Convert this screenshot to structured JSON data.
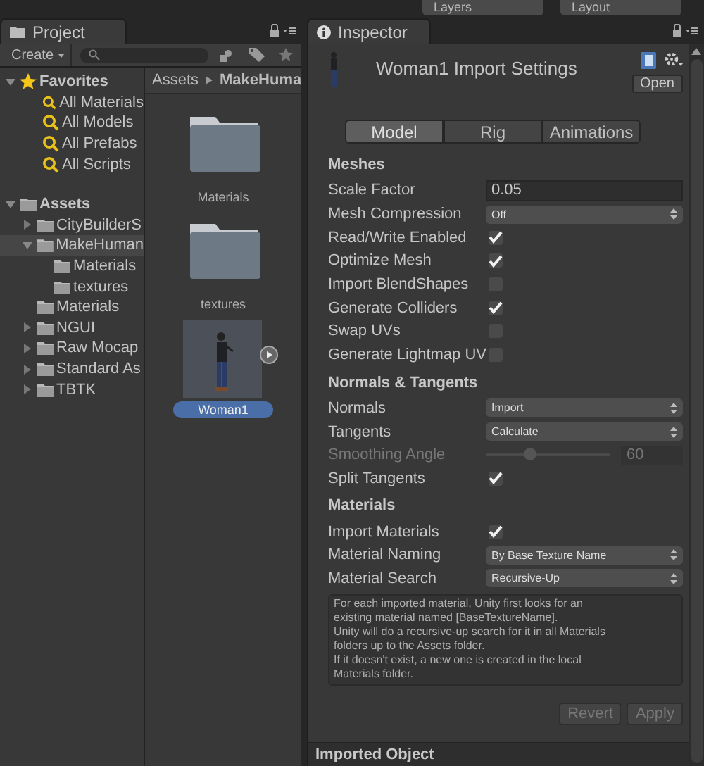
{
  "top_bar": {
    "dropdowns": [
      "Layers",
      "Layout"
    ]
  },
  "project": {
    "tab": "Project",
    "create_button": "Create",
    "tree": [
      {
        "label": "Favorites",
        "kind": "favorites",
        "expanded": true,
        "selected": false,
        "children": [
          {
            "label": "All Materials",
            "kind": "search",
            "selected": false
          },
          {
            "label": "All Models",
            "kind": "search",
            "selected": false
          },
          {
            "label": "All Prefabs",
            "kind": "search",
            "selected": false
          },
          {
            "label": "All Scripts",
            "kind": "search",
            "selected": false
          }
        ]
      },
      {
        "label": "Assets",
        "kind": "folder",
        "expanded": true,
        "selected": false,
        "children": [
          {
            "label": "CityBuilderS",
            "kind": "folder",
            "expanded": false,
            "selected": false
          },
          {
            "label": "MakeHuman",
            "kind": "folder",
            "expanded": true,
            "selected": true,
            "children": [
              {
                "label": "Materials",
                "kind": "folder",
                "selected": false
              },
              {
                "label": "textures",
                "kind": "folder",
                "selected": false
              }
            ]
          },
          {
            "label": "Materials",
            "kind": "folder",
            "selected": false
          },
          {
            "label": "NGUI",
            "kind": "folder",
            "expanded": false,
            "selected": false
          },
          {
            "label": "Raw Mocap",
            "kind": "folder",
            "expanded": false,
            "selected": false
          },
          {
            "label": "Standard As",
            "kind": "folder",
            "expanded": false,
            "selected": false
          },
          {
            "label": "TBTK",
            "kind": "folder",
            "expanded": false,
            "selected": false
          }
        ]
      }
    ],
    "breadcrumb": [
      "Assets",
      "MakeHuma"
    ],
    "assets": [
      {
        "label": "Materials",
        "kind": "folder",
        "selected": false
      },
      {
        "label": "textures",
        "kind": "folder",
        "selected": false
      },
      {
        "label": "Woman1",
        "kind": "model",
        "selected": true
      }
    ]
  },
  "inspector": {
    "tab": "Inspector",
    "title": "Woman1 Import Settings",
    "open_button": "Open",
    "tabs": [
      {
        "label": "Model",
        "selected": true
      },
      {
        "label": "Rig",
        "selected": false
      },
      {
        "label": "Animations",
        "selected": false
      }
    ],
    "sections": [
      {
        "title": "Meshes",
        "rows": [
          {
            "kind": "text",
            "label": "Scale Factor",
            "value": "0.05"
          },
          {
            "kind": "dropdown",
            "label": "Mesh Compression",
            "value": "Off"
          },
          {
            "kind": "checkbox",
            "label": "Read/Write Enabled",
            "checked": true
          },
          {
            "kind": "checkbox",
            "label": "Optimize Mesh",
            "checked": true
          },
          {
            "kind": "checkbox",
            "label": "Import BlendShapes",
            "checked": false
          },
          {
            "kind": "checkbox",
            "label": "Generate Colliders",
            "checked": true
          },
          {
            "kind": "checkbox",
            "label": "Swap UVs",
            "checked": false
          },
          {
            "kind": "checkbox",
            "label": "Generate Lightmap UV",
            "checked": false
          }
        ]
      },
      {
        "title": "Normals & Tangents",
        "rows": [
          {
            "kind": "dropdown",
            "label": "Normals",
            "value": "Import"
          },
          {
            "kind": "dropdown",
            "label": "Tangents",
            "value": "Calculate"
          },
          {
            "kind": "slider",
            "label": "Smoothing Angle",
            "level": 0.35,
            "value": "60",
            "disabled": true
          },
          {
            "kind": "checkbox",
            "label": "Split Tangents",
            "checked": true
          }
        ]
      },
      {
        "title": "Materials",
        "rows": [
          {
            "kind": "checkbox",
            "label": "Import Materials",
            "checked": true
          },
          {
            "kind": "dropdown",
            "label": "Material Naming",
            "value": "By Base Texture Name"
          },
          {
            "kind": "dropdown",
            "label": "Material Search",
            "value": "Recursive-Up"
          }
        ]
      }
    ],
    "help_lines": [
      "For each imported material, Unity first looks for an",
      "existing material named [BaseTextureName].",
      "Unity will do a recursive-up search for it in all Materials",
      "folders up to the Assets folder.",
      "If it doesn't exist, a new one is created in the local",
      "Materials folder."
    ],
    "buttons": [
      {
        "label": "Revert",
        "disabled": true
      },
      {
        "label": "Apply",
        "disabled": true
      }
    ],
    "footer": "Imported Object"
  }
}
